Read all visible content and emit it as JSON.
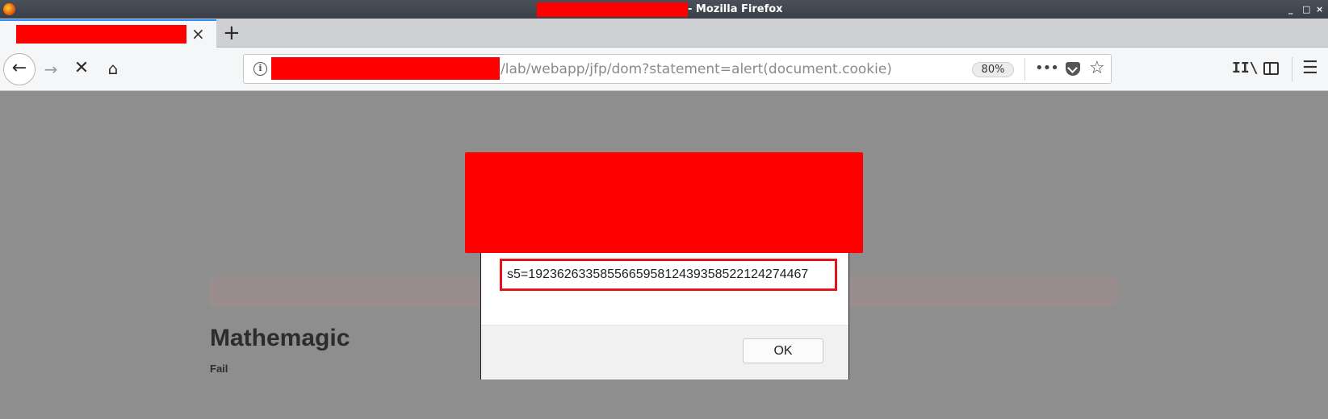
{
  "window": {
    "title_suffix": "- Mozilla Firefox",
    "minimize_glyph": "_",
    "maximize_glyph": "□",
    "close_glyph": "×"
  },
  "tabs": {
    "close_glyph": "×",
    "new_tab_glyph": "+"
  },
  "navbar": {
    "back_glyph": "←",
    "forward_glyph": "→",
    "stop_glyph": "✕",
    "home_glyph": "⌂",
    "info_glyph": "i",
    "url_visible": "/lab/webapp/jfp/dom?statement=alert(document.cookie)",
    "zoom": "80%",
    "more_glyph": "•••",
    "star_glyph": "☆",
    "library_glyph": "II\\",
    "menu_glyph": "☰"
  },
  "page": {
    "heading": "Mathemagic",
    "status": "Fail"
  },
  "dialog": {
    "message": "s5=192362633585566595812439358522124274467",
    "ok_label": "OK"
  },
  "colors": {
    "redaction": "#ff0000",
    "highlight_border": "#e0161c",
    "overlay": "#8e8e8e",
    "tab_accent": "#2a8bff"
  }
}
